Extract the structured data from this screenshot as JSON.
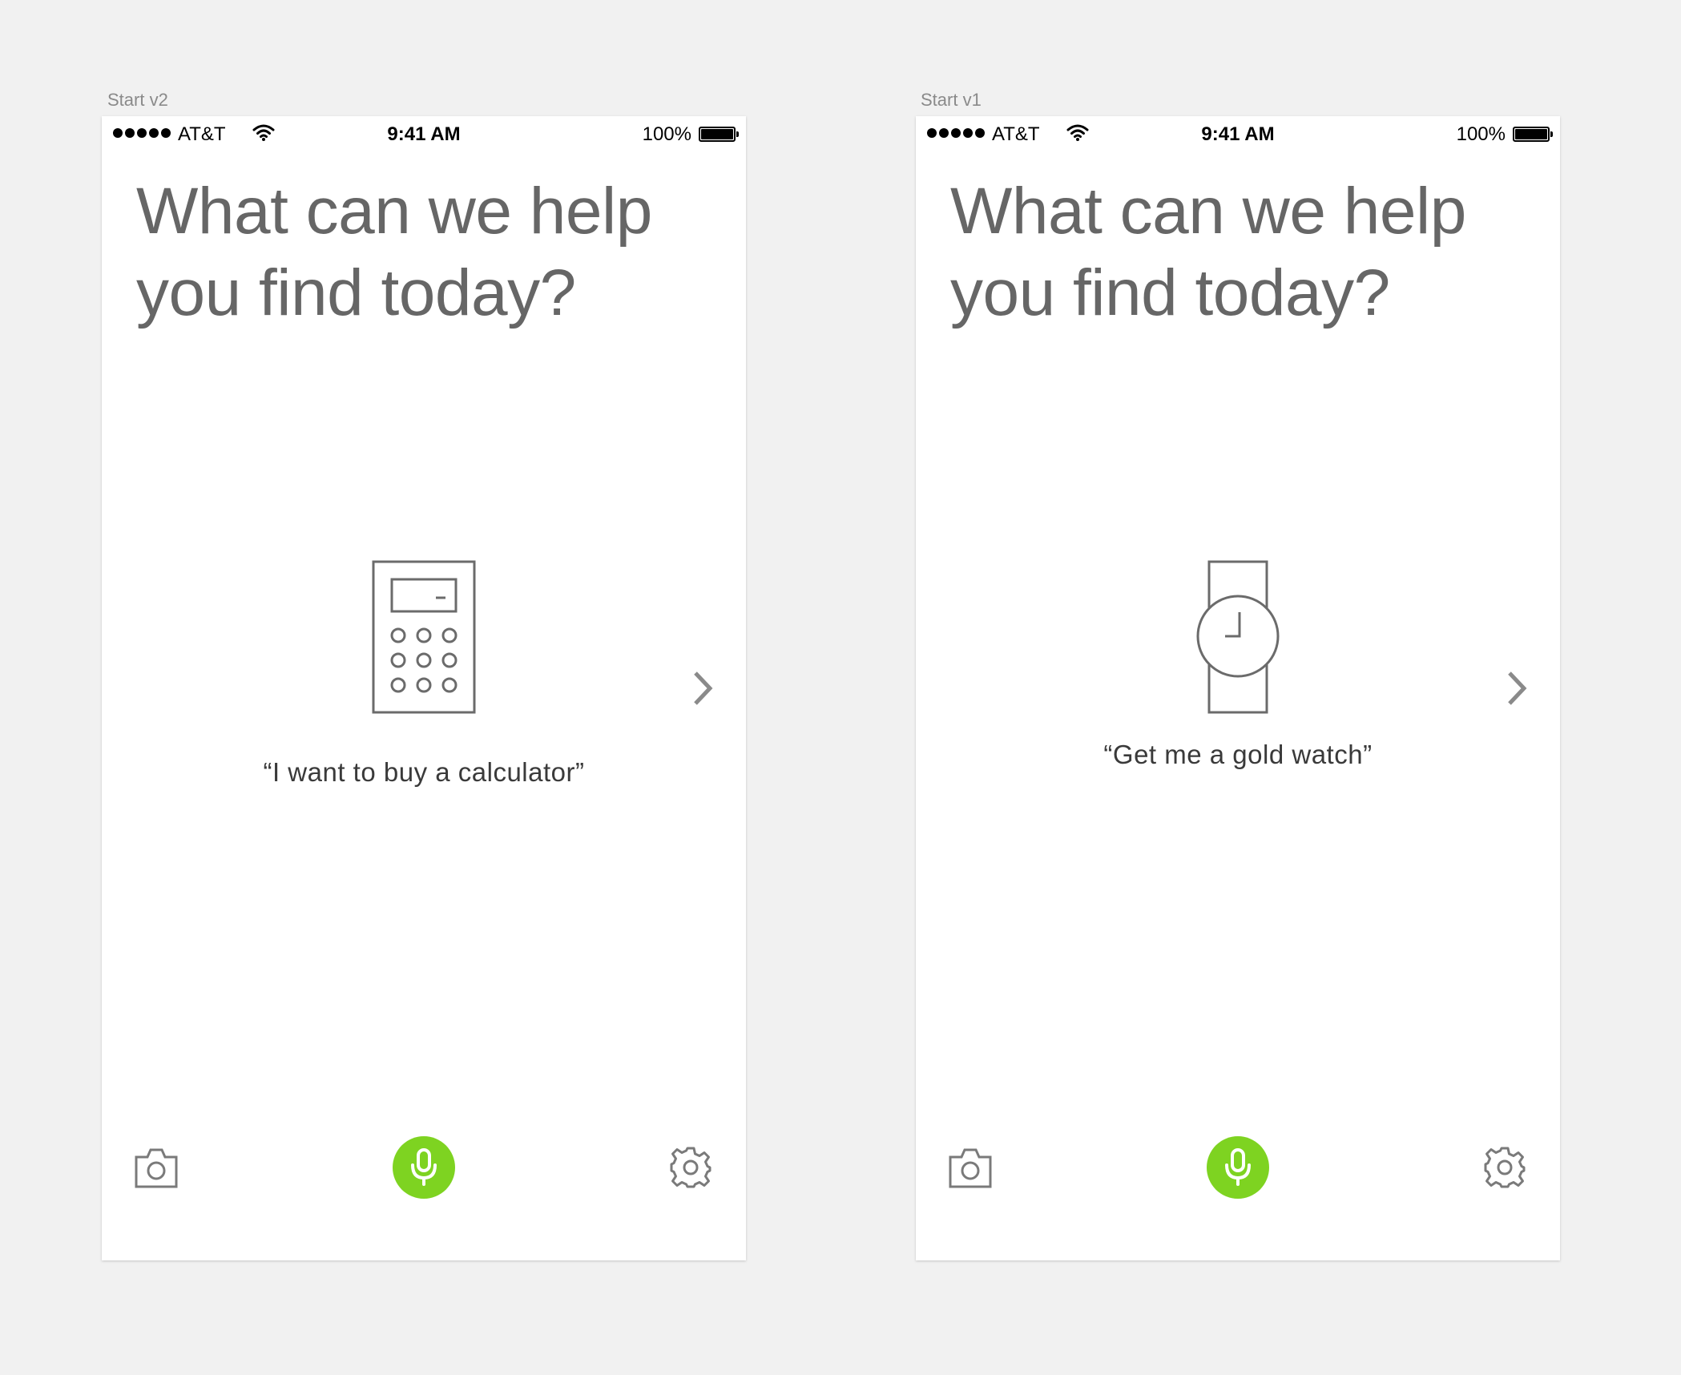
{
  "artboards": [
    {
      "label": "Start v2",
      "status": {
        "carrier": "AT&T",
        "time": "9:41 AM",
        "battery": "100%"
      },
      "headline": "What can we help you find today?",
      "illustration_icon": "calculator-icon",
      "caption": "“I want to buy a calculator”"
    },
    {
      "label": "Start v1",
      "status": {
        "carrier": "AT&T",
        "time": "9:41 AM",
        "battery": "100%"
      },
      "headline": "What can we help you find today?",
      "illustration_icon": "watch-icon",
      "caption": "“Get me a gold watch”"
    }
  ],
  "colors": {
    "accent": "#7ed321",
    "headline": "#666666",
    "icon": "#6b6b6b",
    "background": "#f1f1f1"
  }
}
